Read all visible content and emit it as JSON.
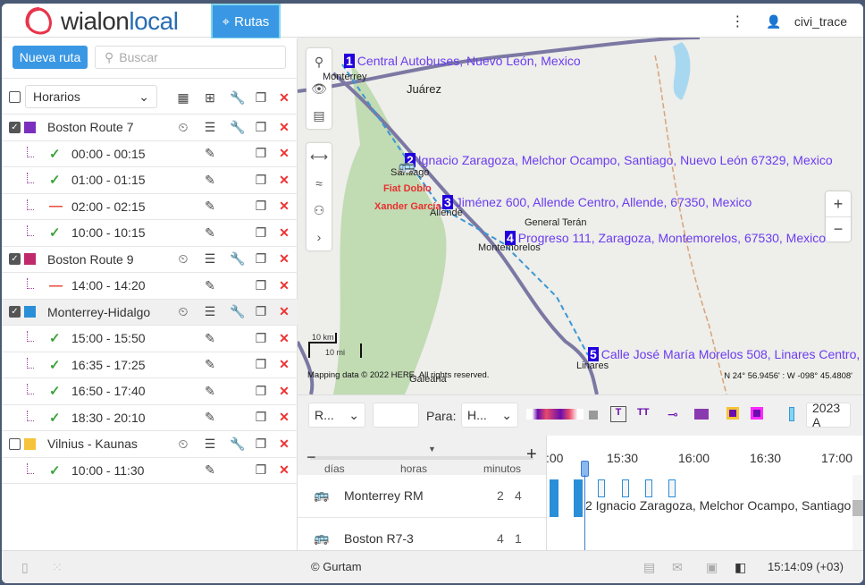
{
  "header": {
    "logo": "wialonlocal",
    "active_app": "Rutas",
    "user": "civi_trace",
    "menu_icon": "more-vertical-icon"
  },
  "sidebar": {
    "new_route": "Nueva ruta",
    "search_placeholder": "Buscar",
    "filter": "Horarios",
    "routes": [
      {
        "name": "Boston Route 7",
        "checked": true,
        "color": "#7b2fbf",
        "schedules": [
          {
            "time": "00:00 - 00:15",
            "status": "ok"
          },
          {
            "time": "01:00 - 01:15",
            "status": "ok"
          },
          {
            "time": "02:00 - 02:15",
            "status": "off"
          },
          {
            "time": "10:00 - 10:15",
            "status": "ok"
          }
        ]
      },
      {
        "name": "Boston Route 9",
        "checked": true,
        "color": "#c02a6a",
        "schedules": [
          {
            "time": "14:00 - 14:20",
            "status": "off"
          }
        ]
      },
      {
        "name": "Monterrey-Hidalgo",
        "checked": true,
        "color": "#2a8ed8",
        "selected": true,
        "schedules": [
          {
            "time": "15:00 - 15:50",
            "status": "ok"
          },
          {
            "time": "16:35 - 17:25",
            "status": "ok"
          },
          {
            "time": "16:50 - 17:40",
            "status": "ok"
          },
          {
            "time": "18:30 - 20:10",
            "status": "ok"
          }
        ]
      },
      {
        "name": "Vilnius - Kaunas",
        "checked": false,
        "color": "#f5c43a",
        "schedules": [
          {
            "time": "10:00 - 11:30",
            "status": "ok"
          }
        ]
      }
    ]
  },
  "map": {
    "stops": [
      {
        "n": "1",
        "label": "Central Autobuses, Nuevo León, Mexico"
      },
      {
        "n": "2",
        "label": "Ignacio Zaragoza, Melchor Ocampo, Santiago, Nuevo León 67329, Mexico"
      },
      {
        "n": "3",
        "label": "Jiménez 600, Allende Centro, Allende, 67350, Mexico"
      },
      {
        "n": "4",
        "label": "Progreso 111, Zaragoza, Montemorelos, 67530, Mexico"
      },
      {
        "n": "5",
        "label": "Calle José María Morelos 508, Linares Centro, L"
      }
    ],
    "cities": [
      "Monterrey",
      "Juárez",
      "Santiago",
      "Allende",
      "General Terán",
      "Montemorelos",
      "Linares",
      "Galeana"
    ],
    "drivers": [
      "Fiat Doblo",
      "Xander García"
    ],
    "scale_km": "10 km",
    "scale_mi": "10 mi",
    "copyright": "Mapping data © 2022 HERE, All rights reserved.",
    "coords": "N 24° 56.9456' : W -098° 45.4808'"
  },
  "timeline": {
    "dd1": "R...",
    "para_label": "Para:",
    "dd2": "H...",
    "date": "2023 A",
    "scale_labels": [
      "días",
      "horas",
      "minutos"
    ],
    "ticks": [
      ":00",
      "15:30",
      "16:00",
      "16:30",
      "17:00"
    ],
    "units": [
      {
        "name": "Monterrey RM",
        "a": "2",
        "b": "4"
      },
      {
        "name": "Boston R7-3",
        "a": "4",
        "b": "1"
      }
    ],
    "tooltip": "2 Ignacio Zaragoza, Melchor Ocampo, Santiago"
  },
  "footer": {
    "copyright": "© Gurtam",
    "time": "15:14:09 (+03)"
  }
}
